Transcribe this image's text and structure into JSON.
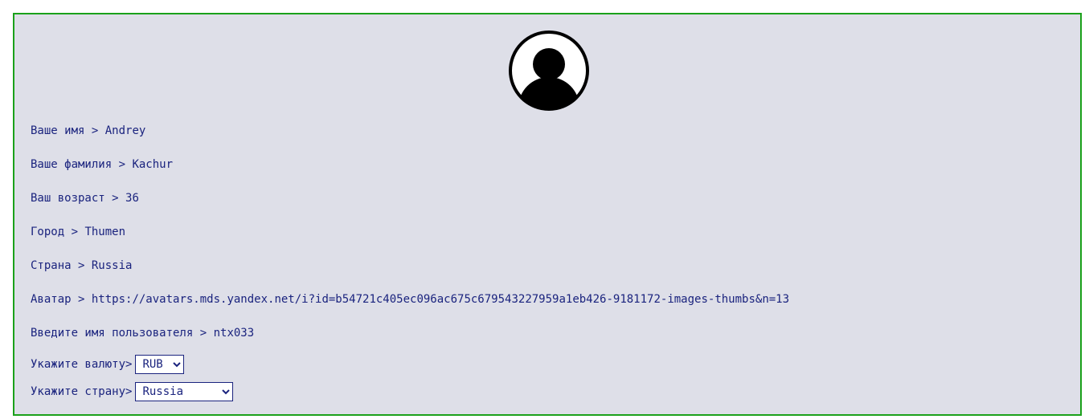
{
  "profile": {
    "fields": [
      {
        "label": "Ваше имя",
        "sep": " > ",
        "value": "Andrey"
      },
      {
        "label": "Ваше фамилия",
        "sep": " > ",
        "value": "Kachur"
      },
      {
        "label": "Ваш возраст",
        "sep": " > ",
        "value": "36"
      },
      {
        "label": "Город",
        "sep": " > ",
        "value": "Thumen"
      },
      {
        "label": "Страна",
        "sep": " > ",
        "value": "Russia"
      },
      {
        "label": "Аватар",
        "sep": " > ",
        "value": "https://avatars.mds.yandex.net/i?id=b54721c405ec096ac675c679543227959a1eb426-9181172-images-thumbs&n=13"
      },
      {
        "label": "Введите имя пользователя",
        "sep": " > ",
        "value": "ntx033"
      }
    ],
    "currency": {
      "label": "Укажите валюту>",
      "selected": "RUB"
    },
    "country": {
      "label": "Укажите страну>",
      "selected": "Russia"
    }
  },
  "colors": {
    "border": "#1aa11a",
    "background": "#dedfe8",
    "text": "#1a237e"
  },
  "icons": {
    "avatar": "user-avatar-icon"
  }
}
